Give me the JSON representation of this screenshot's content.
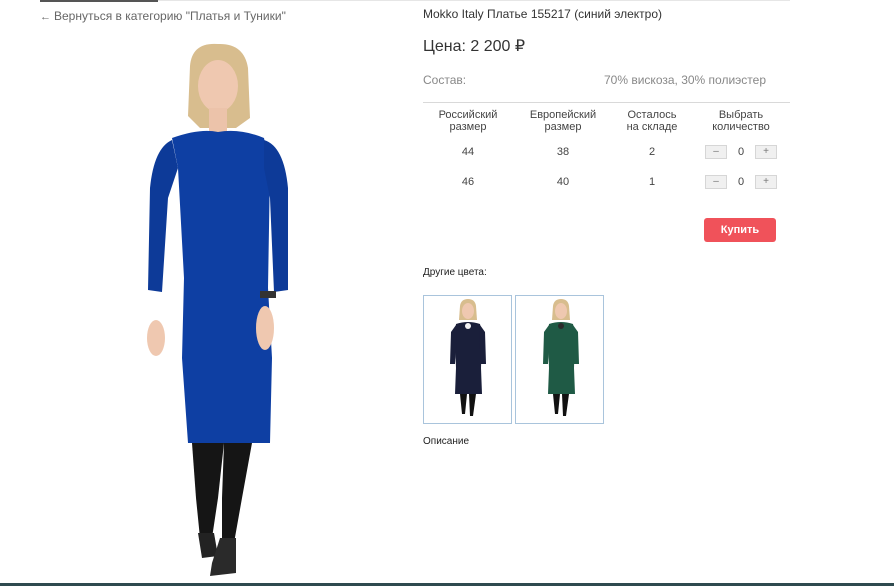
{
  "nav": {
    "back_link": "Вернуться в категорию \"Платья и Туники\""
  },
  "product": {
    "title": "Mokko Italy Платье 155217 (синий электро)",
    "price": "Цена: 2 200 ₽",
    "composition_label": "Состав:",
    "composition_value": "70% вискоза, 30% полиэстер",
    "dress_color": "#0e3fa3"
  },
  "sizes_table": {
    "headers": {
      "ru": [
        "Российский",
        "размер"
      ],
      "eu": [
        "Европейский",
        "размер"
      ],
      "stock": [
        "Осталось",
        "на складе"
      ],
      "qty": [
        "Выбрать",
        "количество"
      ]
    },
    "rows": [
      {
        "ru": "44",
        "eu": "38",
        "stock": "2",
        "qty": "0"
      },
      {
        "ru": "46",
        "eu": "40",
        "stock": "1",
        "qty": "0"
      }
    ],
    "minus": "–",
    "plus": "+"
  },
  "buy_button": "Купить",
  "other_colors": {
    "label": "Другие цвета:",
    "items": [
      {
        "name": "navy",
        "color": "#1a1f3a"
      },
      {
        "name": "green",
        "color": "#1f5a45"
      }
    ]
  },
  "description_label": "Описание",
  "colors": {
    "accent": "#f0525a",
    "thumb_border": "#a9c4dc"
  }
}
